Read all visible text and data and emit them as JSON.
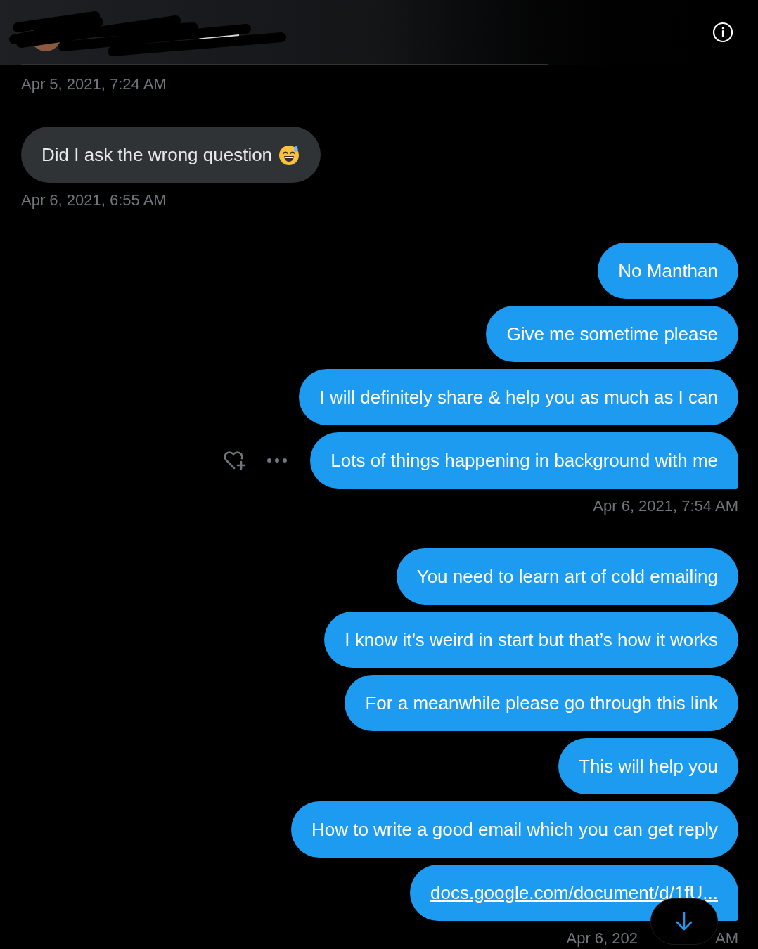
{
  "groups": [
    {
      "kind": "received",
      "timestamp": [
        "Apr 5, 2021, 7:24 AM"
      ]
    },
    {
      "kind": "received",
      "timestamp": [
        "Apr 6, 2021, 6:55 AM"
      ],
      "messages": [
        {
          "kind": "emoji_text",
          "text": "Did I ask the wrong question",
          "hovered": false
        }
      ]
    },
    {
      "kind": "sent",
      "timestamp": [
        "Apr 6, 2021, 7:54 AM"
      ],
      "messages": [
        {
          "kind": "text",
          "text": "No Manthan",
          "hovered": false
        },
        {
          "kind": "text",
          "text": "Give me sometime please",
          "hovered": false
        },
        {
          "kind": "text",
          "text": "I will definitely share & help you as much as I can",
          "hovered": false
        },
        {
          "kind": "text",
          "text": "Lots of things happening in background with me",
          "hovered": true
        }
      ]
    },
    {
      "kind": "sent",
      "timestamp": [
        "Apr 6, 202",
        "AM"
      ],
      "messages": [
        {
          "kind": "text",
          "text": "You need to learn art of cold emailing",
          "hovered": false
        },
        {
          "kind": "text",
          "text": "I know it’s weird in start but that’s how it works",
          "hovered": false
        },
        {
          "kind": "text",
          "text": "For a meanwhile please go through this link",
          "hovered": false
        },
        {
          "kind": "text",
          "text": "This will help you",
          "hovered": false
        },
        {
          "kind": "text",
          "text": "How to write a good email which you can get reply",
          "hovered": false
        },
        {
          "kind": "link",
          "text": "docs.google.com/document/d/1fU...",
          "hovered": false
        }
      ]
    }
  ]
}
